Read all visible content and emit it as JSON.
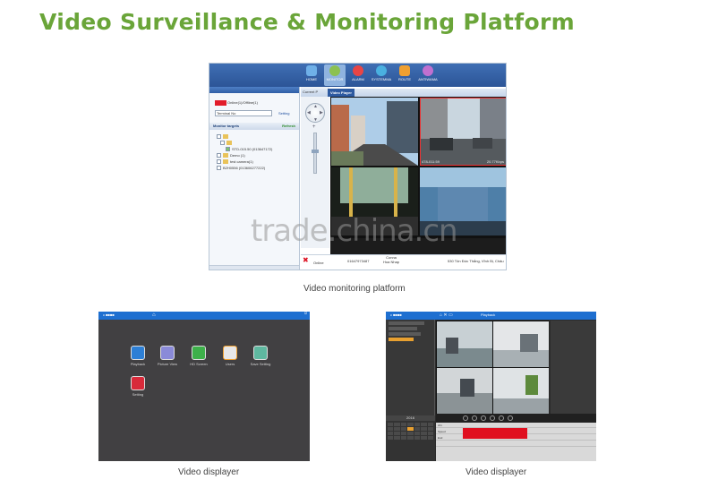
{
  "page": {
    "title": "Video Surveillance & Monitoring Platform",
    "watermark": "trade.china.cn"
  },
  "monitor_app": {
    "nav": [
      {
        "label": "HOME",
        "icon": "home-icon",
        "color": "#6fb0e8"
      },
      {
        "label": "MONITOR",
        "icon": "monitor-icon",
        "color": "#8cc152"
      },
      {
        "label": "ALARM",
        "icon": "alarm-icon",
        "color": "#e94545"
      },
      {
        "label": "SYSTEMMA",
        "icon": "gear-icon",
        "color": "#4ab0e0"
      },
      {
        "label": "ROUTE",
        "icon": "route-icon",
        "color": "#f0a030"
      },
      {
        "label": "ANTIWAMA",
        "icon": "antenna-icon",
        "color": "#c070d0"
      }
    ],
    "status_text": "Online(1)/Offline(1)",
    "terminal_select": "Terminal No",
    "setting_label": "Setting",
    "monitor_targets_label": "Monitor targets",
    "refresh_label": "Refresh",
    "tree": [
      "",
      "",
      "STD-015.50 (013647172)",
      "Demo (1)",
      "test camera(1)",
      "B2H0556 (013606277222)"
    ],
    "tabs": {
      "current": "Current P",
      "video": "Video Player"
    },
    "video_info": {
      "cell2_left": "478-011:59",
      "cell2_right": "20.77Kbps"
    },
    "status_row": {
      "online": "Online",
      "phone": "01647973487",
      "company_line1": "Conna",
      "company_line2": "Hoa Nhap",
      "address": "530 Tôn Đức Thắng, Vĩnh Bị, Châu"
    },
    "caption": "Video monitoring platform"
  },
  "displayer_app": {
    "apps": [
      {
        "name": "Playback",
        "icon": "playback-icon",
        "color": "#2d7fd5"
      },
      {
        "name": "Picture View",
        "icon": "picture-view-icon",
        "color": "#8a8ad8"
      },
      {
        "name": "HD Screen",
        "icon": "hd-screen-icon",
        "color": "#3db04a"
      },
      {
        "name": "Users",
        "icon": "users-icon",
        "color": "#e8e8e8"
      },
      {
        "name": "Save Setting",
        "icon": "save-setting-icon",
        "color": "#5fb8a0"
      },
      {
        "name": "Setting",
        "icon": "settings-gear-icon",
        "color": "#d82a3a"
      }
    ],
    "caption": "Video displayer"
  },
  "playback_app": {
    "title": "Playback",
    "calendar_header": "2016",
    "timeline_labels": [
      "ch1",
      "Speed",
      "End"
    ],
    "caption": "Video displayer"
  }
}
